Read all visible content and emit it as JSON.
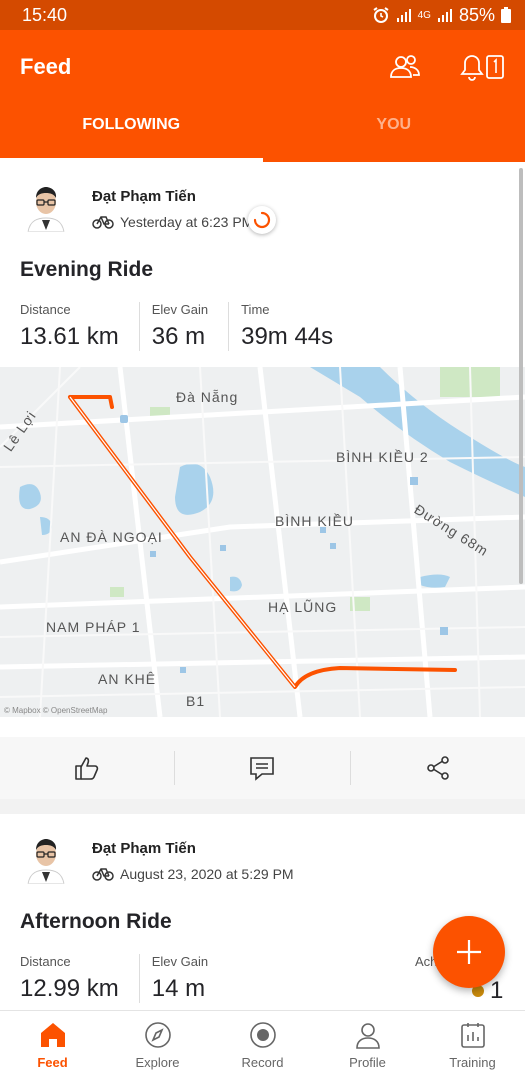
{
  "status_bar": {
    "time": "15:40",
    "network": "4G",
    "battery": "85%"
  },
  "header": {
    "title": "Feed"
  },
  "tabs": [
    {
      "label": "FOLLOWING",
      "active": true
    },
    {
      "label": "YOU",
      "active": false
    }
  ],
  "activities": [
    {
      "athlete": "Đạt Phạm Tiến",
      "type_icon": "bike-icon",
      "datetime": "Yesterday at 6:23 PM",
      "title": "Evening Ride",
      "stats": [
        {
          "label": "Distance",
          "value": "13.61 km"
        },
        {
          "label": "Elev Gain",
          "value": "36 m"
        },
        {
          "label": "Time",
          "value": "39m 44s"
        }
      ],
      "map": {
        "labels": [
          "Đà Nẵng",
          "Lê Lợi",
          "BÌNH KIỀU 2",
          "BÌNH KIỀU",
          "AN ĐÀ NGOẠI",
          "Đường 68m",
          "HẠ LŨNG",
          "NAM PHÁP 1",
          "AN KHÊ",
          "B1"
        ],
        "attribution": "© Mapbox © OpenStreetMap"
      }
    },
    {
      "athlete": "Đạt Phạm Tiến",
      "type_icon": "bike-icon",
      "datetime": "August 23, 2020 at 5:29 PM",
      "title": "Afternoon Ride",
      "stats": [
        {
          "label": "Distance",
          "value": "12.99 km"
        },
        {
          "label": "Elev Gain",
          "value": "14 m"
        }
      ],
      "achievements": {
        "label": "Ach",
        "value": "1"
      }
    }
  ],
  "actions": [
    {
      "name": "kudos",
      "icon": "thumbs-up-icon"
    },
    {
      "name": "comment",
      "icon": "comment-icon"
    },
    {
      "name": "share",
      "icon": "share-icon"
    }
  ],
  "bottom_nav": [
    {
      "label": "Feed",
      "icon": "home-icon",
      "active": true
    },
    {
      "label": "Explore",
      "icon": "compass-icon",
      "active": false
    },
    {
      "label": "Record",
      "icon": "record-icon",
      "active": false
    },
    {
      "label": "Profile",
      "icon": "profile-icon",
      "active": false
    },
    {
      "label": "Training",
      "icon": "training-icon",
      "active": false
    }
  ],
  "colors": {
    "brand": "#fc5200",
    "status_bar": "#d44a00",
    "route": "#fc5200"
  }
}
